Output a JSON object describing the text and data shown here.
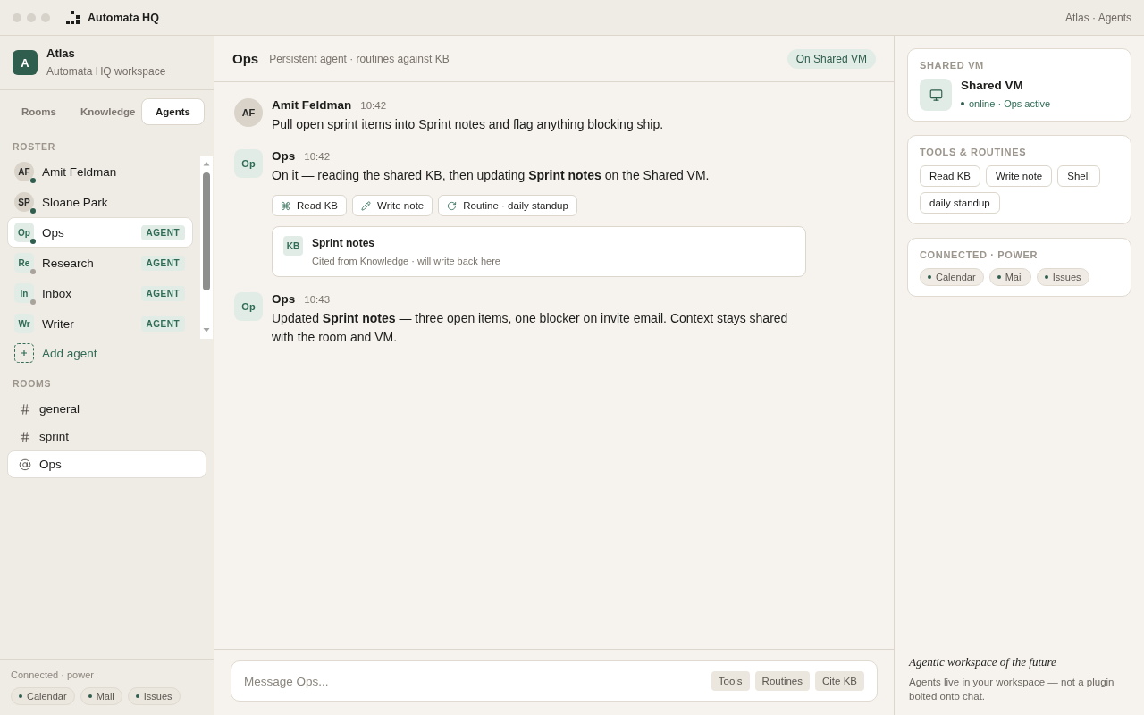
{
  "titlebar": {
    "app_name": "Automata HQ",
    "breadcrumb": "Atlas · Agents"
  },
  "workspace": {
    "initial": "A",
    "name": "Atlas",
    "subtitle": "Automata HQ workspace"
  },
  "sidebar_tabs": [
    {
      "label": "Rooms",
      "selected": false
    },
    {
      "label": "Knowledge",
      "selected": false
    },
    {
      "label": "Agents",
      "selected": true
    }
  ],
  "roster": {
    "heading": "ROSTER",
    "members": [
      {
        "kind": "person",
        "initials": "AF",
        "name": "Amit Feldman",
        "online": true,
        "selected": false
      },
      {
        "kind": "person",
        "initials": "SP",
        "name": "Sloane Park",
        "online": true,
        "selected": false
      },
      {
        "kind": "agent",
        "initials": "Op",
        "name": "Ops",
        "badge": "AGENT",
        "online": true,
        "selected": true
      },
      {
        "kind": "agent",
        "initials": "Re",
        "name": "Research",
        "badge": "AGENT",
        "online": false,
        "selected": false
      },
      {
        "kind": "agent",
        "initials": "In",
        "name": "Inbox",
        "badge": "AGENT",
        "online": false,
        "selected": false
      },
      {
        "kind": "agent",
        "initials": "Wr",
        "name": "Writer",
        "badge": "AGENT",
        "selected": false
      }
    ],
    "add_label": "Add agent"
  },
  "rooms": {
    "heading": "ROOMS",
    "items": [
      {
        "kind": "channel",
        "name": "general",
        "selected": false
      },
      {
        "kind": "channel",
        "name": "sprint",
        "selected": false
      },
      {
        "kind": "direct",
        "name": "Ops",
        "selected": true
      }
    ]
  },
  "sidebar_footer": {
    "label": "Connected · power",
    "integrations": [
      "Calendar",
      "Mail",
      "Issues"
    ]
  },
  "conversation": {
    "title": "Ops",
    "description": "Persistent agent · routines against KB",
    "status": "On Shared VM"
  },
  "messages": [
    {
      "kind": "person",
      "initials": "AF",
      "author": "Amit Feldman",
      "time": "10:42",
      "text": "Pull open sprint items into Sprint notes and flag anything blocking ship."
    },
    {
      "kind": "agent",
      "initials": "Op",
      "author": "Ops",
      "time": "10:42",
      "text": "On it — reading the shared KB, then updating **Sprint notes** on the Shared VM.",
      "actions": [
        {
          "kind": "command",
          "label": "Read KB"
        },
        {
          "kind": "edit",
          "label": "Write note"
        },
        {
          "kind": "routine",
          "label": "Routine · daily standup"
        }
      ],
      "citation": {
        "badge": "KB",
        "title": "Sprint notes",
        "note": "Cited from Knowledge · will write back here"
      }
    },
    {
      "kind": "agent",
      "initials": "Op",
      "author": "Ops",
      "time": "10:43",
      "text": "Updated **Sprint notes** — three open items, one blocker on invite email. Context stays shared with the room and VM."
    }
  ],
  "composer": {
    "placeholder": "Message Ops...",
    "actions": [
      "Tools",
      "Routines",
      "Cite KB"
    ]
  },
  "details": {
    "vm_card": {
      "heading": "SHARED VM",
      "name": "Shared VM",
      "status": "online · Ops active"
    },
    "tools_card": {
      "heading": "TOOLS & ROUTINES",
      "items": [
        "Read KB",
        "Write note",
        "Shell",
        "daily standup"
      ]
    },
    "power_card": {
      "heading": "CONNECTED · POWER",
      "integrations": [
        "Calendar",
        "Mail",
        "Issues"
      ]
    },
    "tagline": "Agentic workspace of the future",
    "blurb": "Agents live in your workspace — not a plugin bolted onto chat."
  }
}
